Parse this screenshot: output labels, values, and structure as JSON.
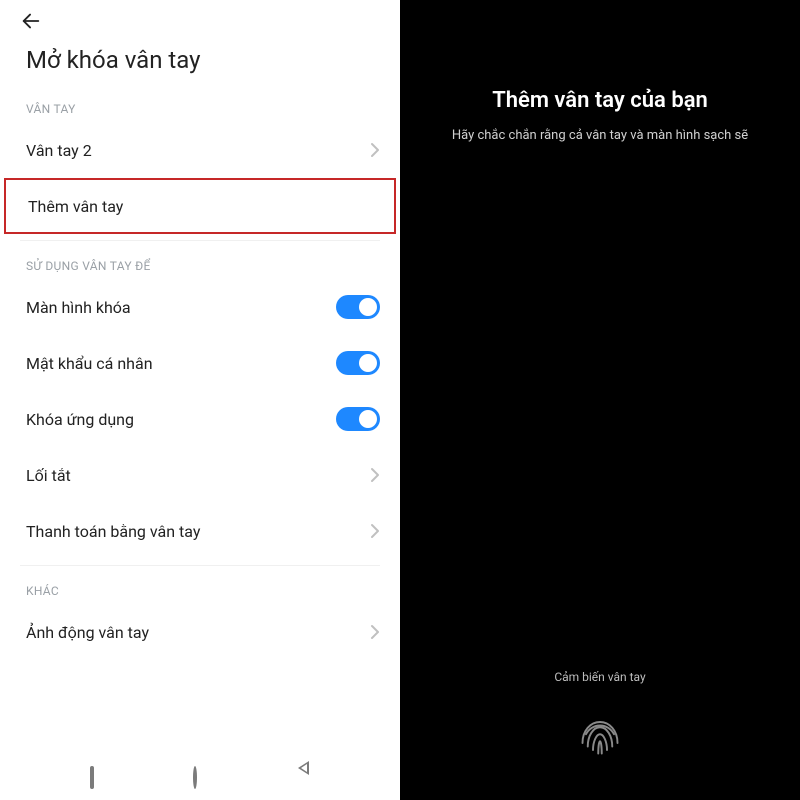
{
  "left": {
    "page_title": "Mở khóa vân tay",
    "sections": {
      "fingerprint": {
        "label": "VÂN TAY",
        "items": [
          {
            "label": "Vân tay 2"
          },
          {
            "label": "Thêm vân tay"
          }
        ]
      },
      "use_for": {
        "label": "SỬ DỤNG VÂN TAY ĐỂ",
        "toggles": [
          {
            "label": "Màn hình khóa",
            "on": true
          },
          {
            "label": "Mật khẩu cá nhân",
            "on": true
          },
          {
            "label": "Khóa ứng dụng",
            "on": true
          }
        ],
        "links": [
          {
            "label": "Lối tắt"
          },
          {
            "label": "Thanh toán bằng vân tay"
          }
        ]
      },
      "other": {
        "label": "KHÁC",
        "items": [
          {
            "label": "Ảnh động vân tay"
          }
        ]
      }
    }
  },
  "right": {
    "title": "Thêm vân tay của bạn",
    "subtitle": "Hãy chắc chắn rằng cả vân tay và màn hình sạch sẽ",
    "sensor_label": "Cảm biến vân tay"
  }
}
